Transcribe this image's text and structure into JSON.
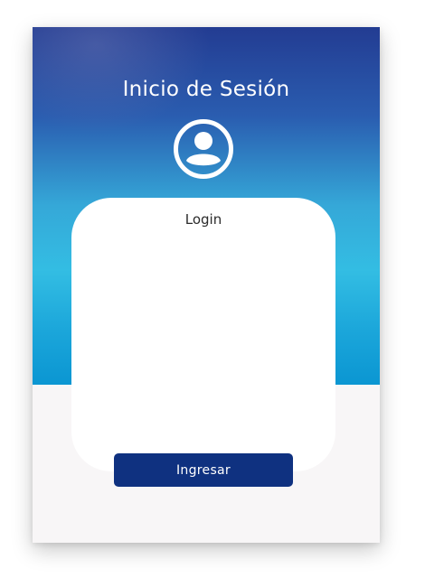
{
  "header": {
    "title": "Inicio de Sesión",
    "avatar_icon": "user-circle-icon"
  },
  "card": {
    "title": "Login"
  },
  "actions": {
    "submit_label": "Ingresar"
  },
  "colors": {
    "header_top": "#233c92",
    "header_mid": "#33bde3",
    "header_bottom": "#0b96d2",
    "background": "#f8f6f7",
    "card": "#ffffff",
    "button": "#0f3180",
    "button_text": "#ffffff"
  }
}
